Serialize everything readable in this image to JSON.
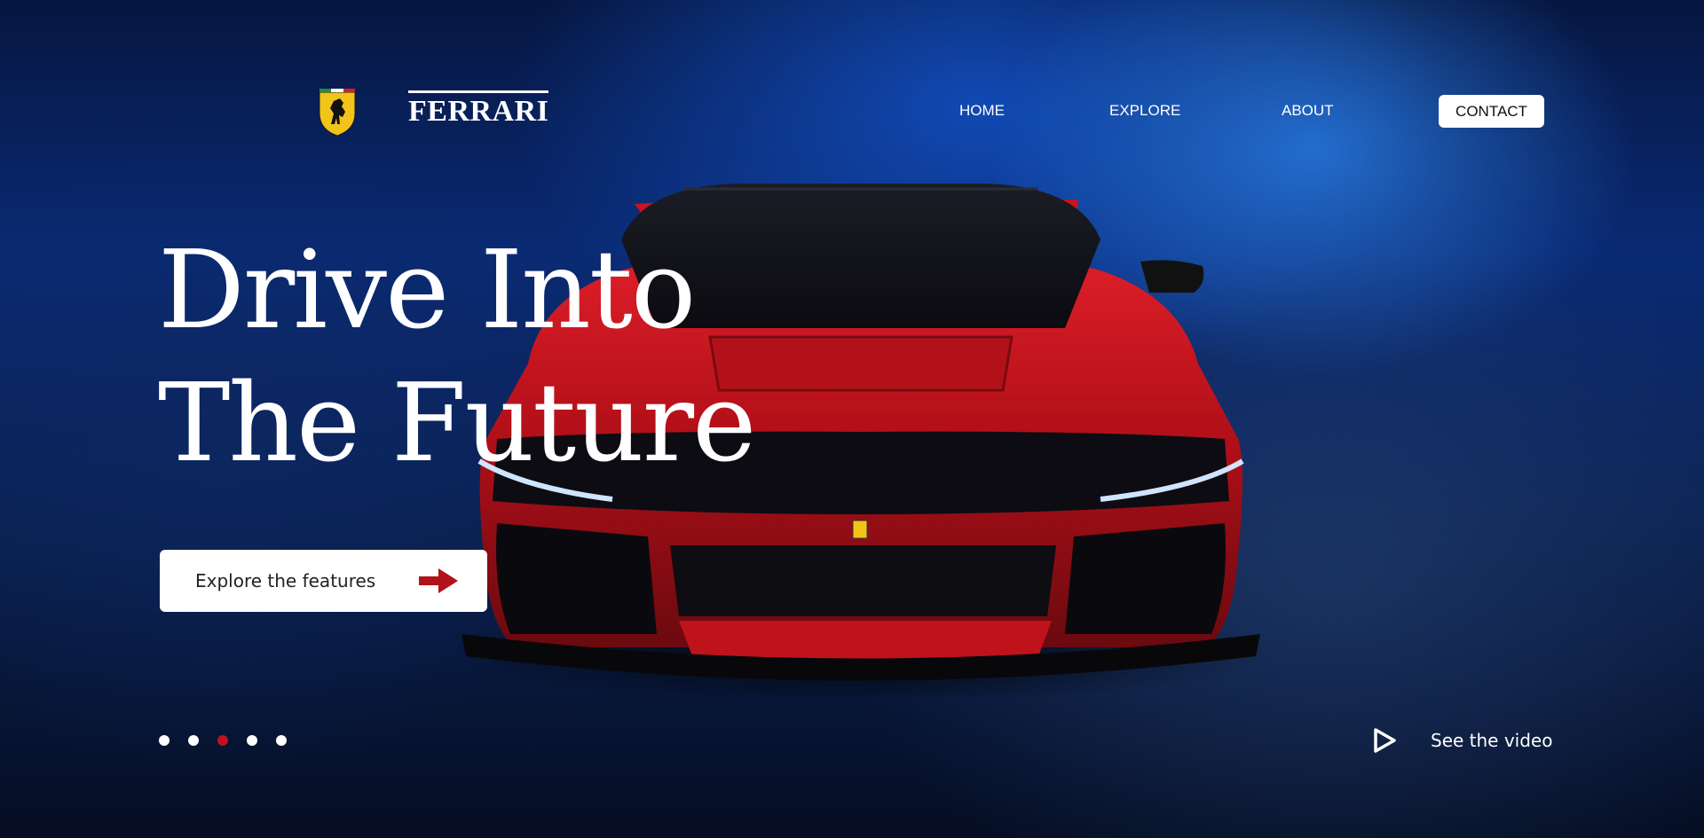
{
  "header": {
    "brand": "FERRARI",
    "nav": [
      {
        "label": "HOME"
      },
      {
        "label": "EXPLORE"
      },
      {
        "label": "ABOUT"
      }
    ],
    "contact_label": "CONTACT"
  },
  "hero": {
    "headline_line1": "Drive Into",
    "headline_line2": "The Future",
    "cta_label": "Explore the features"
  },
  "slider": {
    "total": 5,
    "active_index": 2,
    "active_color": "#c2121c",
    "inactive_color": "#ffffff"
  },
  "video": {
    "label": "See the video"
  },
  "colors": {
    "accent_red": "#b3121a",
    "logo_yellow": "#f2c41a",
    "background_blue": "#0a2a74"
  },
  "icons": {
    "logo": "prancing-horse-shield-icon",
    "cta": "arrow-right-icon",
    "video": "play-icon"
  }
}
